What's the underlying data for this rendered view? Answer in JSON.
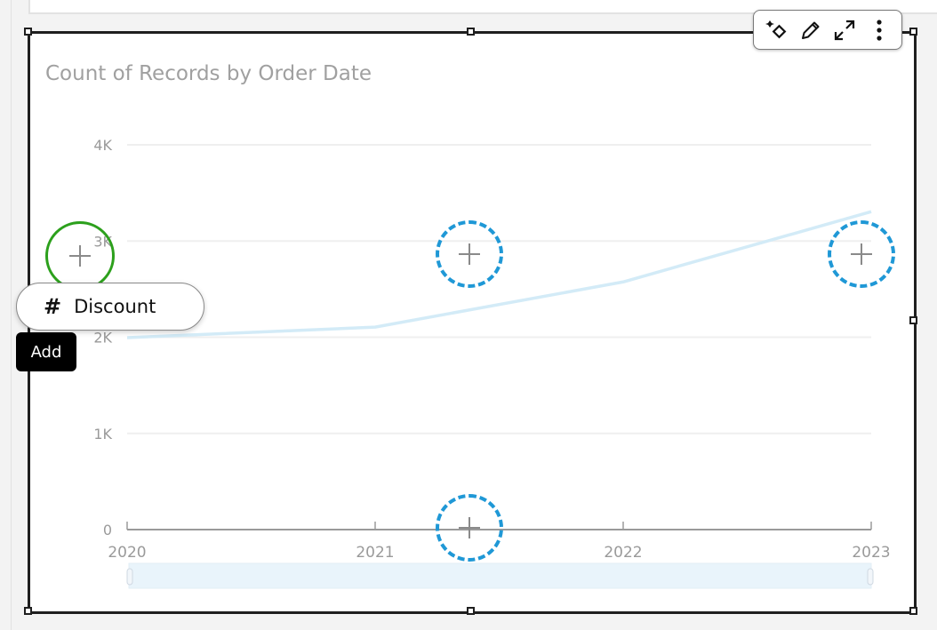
{
  "visual": {
    "title": "Count of Records by Order Date",
    "toolbar": [
      {
        "name": "ai-insights-icon",
        "label": "Insights"
      },
      {
        "name": "edit-icon",
        "label": "Edit"
      },
      {
        "name": "expand-icon",
        "label": "Expand"
      },
      {
        "name": "more-options-icon",
        "label": "More options"
      }
    ]
  },
  "drag": {
    "field_icon": "#",
    "field_label": "Discount",
    "tooltip": "Add"
  },
  "colors": {
    "line": "#d3ebf7",
    "drop_target": "#1f98d6",
    "active_target": "#2ca01c",
    "range_slider": "#e9f4fb"
  },
  "chart_data": {
    "type": "line",
    "title": "Count of Records by Order Date",
    "xlabel": "",
    "ylabel": "",
    "categories": [
      "2020",
      "2021",
      "2022",
      "2023"
    ],
    "series": [
      {
        "name": "Count of Records",
        "values": [
          1995,
          2105,
          2575,
          3305
        ]
      }
    ],
    "yticks": [
      0,
      1000,
      2000,
      3000,
      4000
    ],
    "ytick_labels": [
      "0",
      "1K",
      "2K",
      "3K",
      "4K"
    ],
    "ylim": [
      0,
      4000
    ],
    "grid": true,
    "legend": "none"
  }
}
